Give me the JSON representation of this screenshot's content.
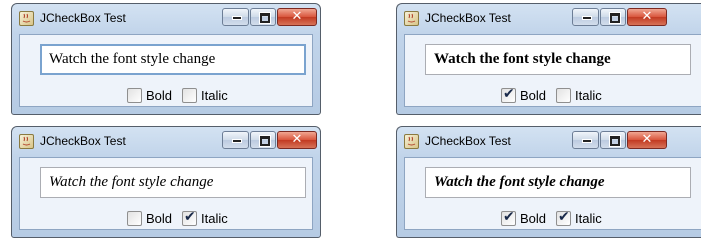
{
  "window_title": "JCheckBox Test",
  "text": "Watch the font style change",
  "bold_label": "Bold",
  "italic_label": "Italic",
  "close_glyph": "✕",
  "check_glyph": "✔",
  "windows": [
    {
      "bold": false,
      "italic": false,
      "focused": true
    },
    {
      "bold": true,
      "italic": false,
      "focused": false
    },
    {
      "bold": false,
      "italic": true,
      "focused": false
    },
    {
      "bold": true,
      "italic": true,
      "focused": false
    }
  ]
}
